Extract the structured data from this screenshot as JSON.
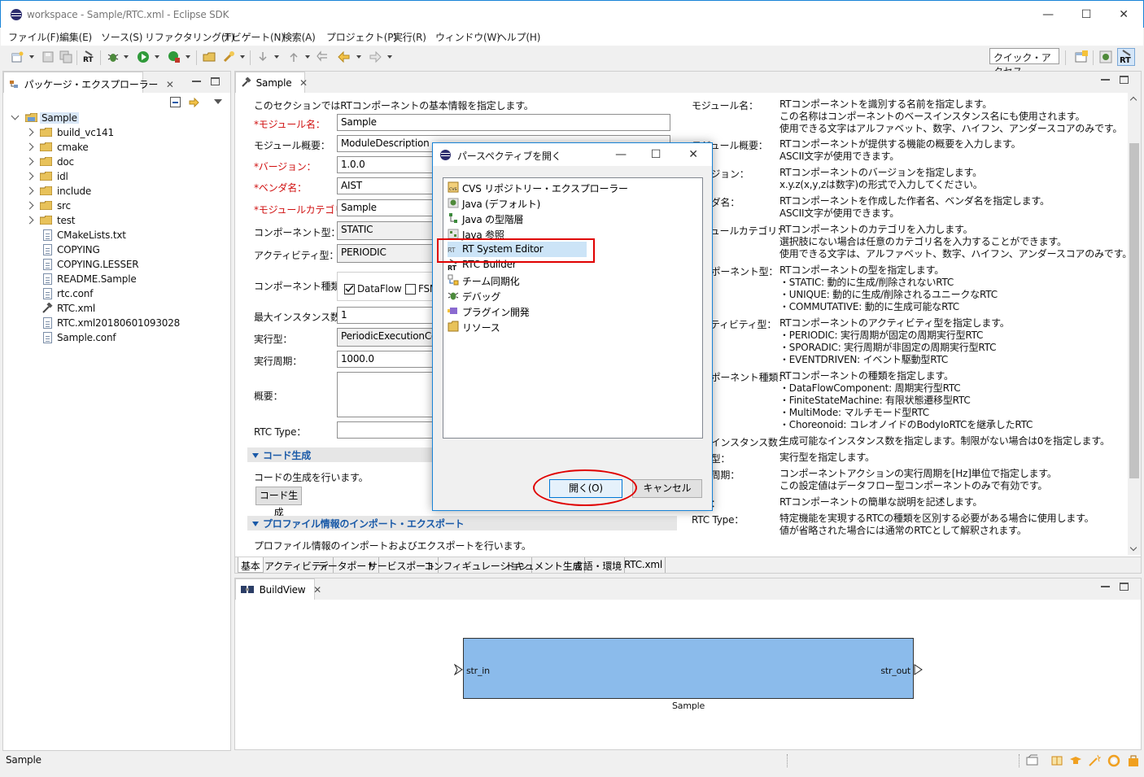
{
  "window": {
    "title": "workspace - Sample/RTC.xml - Eclipse SDK",
    "minimize": "—",
    "maximize": "☐",
    "close": "✕"
  },
  "menu": [
    "ファイル(F)",
    "編集(E)",
    "ソース(S)",
    "リファクタリング(T)",
    "ナビゲート(N)",
    "検索(A)",
    "プロジェクト(P)",
    "実行(R)",
    "ウィンドウ(W)",
    "ヘルプ(H)"
  ],
  "toolbar": {
    "quick_access": "クイック・アクセス"
  },
  "explorer": {
    "tab_label": "パッケージ・エクスプローラー",
    "root": "Sample",
    "folders": [
      "build_vc141",
      "cmake",
      "doc",
      "idl",
      "include",
      "src",
      "test"
    ],
    "files": [
      "CMakeLists.txt",
      "COPYING",
      "COPYING.LESSER",
      "README.Sample",
      "rtc.conf",
      "RTC.xml",
      "RTC.xml20180601093028",
      "Sample.conf"
    ]
  },
  "editor": {
    "tab_label": "Sample",
    "intro": "このセクションではRTコンポーネントの基本情報を指定します。",
    "fields": {
      "module_name_label": "*モジュール名：",
      "module_name": "Sample",
      "module_desc_label": "モジュール概要：",
      "module_desc": "ModuleDescription",
      "version_label": "*バージョン：",
      "version": "1.0.0",
      "vendor_label": "*ベンダ名：",
      "vendor": "AIST",
      "category_label": "*モジュールカテゴリ：",
      "category": "Sample",
      "comp_type_label": "コンポーネント型：",
      "comp_type": "STATIC",
      "activity_type_label": "アクティビティ型：",
      "activity_type": "PERIODIC",
      "comp_kind_label": "コンポーネント種類：",
      "dataflow_label": "DataFlow",
      "fsm_label": "FSM",
      "max_inst_label": "最大インスタンス数：",
      "max_inst": "1",
      "exec_type_label": "実行型：",
      "exec_type": "PeriodicExecutionContext",
      "exec_rate_label": "実行周期：",
      "exec_rate": "1000.0",
      "overview_label": "概要：",
      "rtc_type_label": "RTC Type："
    },
    "codegen_header": "コード生成",
    "codegen_desc": "コードの生成を行います。",
    "codegen_button": "コード生成",
    "profile_header": "プロファイル情報のインポート・エクスポート",
    "profile_desc": "プロファイル情報のインポートおよびエクスポートを行います。",
    "help": {
      "module_name_label": "モジュール名：",
      "module_name": "RTコンポーネントを識別する名前を指定します。\nこの名称はコンポーネントのベースインスタンス名にも使用されます。\n使用できる文字はアルファベット、数字、ハイフン、アンダースコアのみです。",
      "module_desc_label": "モジュール概要：",
      "module_desc": "RTコンポーネントが提供する機能の概要を入力します。\nASCII文字が使用できます。",
      "version_label": "バージョン：",
      "version": "RTコンポーネントのバージョンを指定します。\nx.y.z(x,y,zは数字)の形式で入力してください。",
      "vendor_label": "ベンダ名：",
      "vendor": "RTコンポーネントを作成した作者名、ベンダ名を指定します。\nASCII文字が使用できます。",
      "category_label": "モジュールカテゴリ：",
      "category": "RTコンポーネントのカテゴリを入力します。\n選択肢にない場合は任意のカテゴリ名を入力することができます。\n使用できる文字は、アルファベット、数字、ハイフン、アンダースコアのみです。",
      "comp_type_label": "コンポーネント型：",
      "comp_type": "RTコンポーネントの型を指定します。\n・STATIC: 動的に生成/削除されないRTC\n・UNIQUE: 動的に生成/削除されるユニークなRTC\n・COMMUTATIVE: 動的に生成可能なRTC",
      "activity_label": "アクティビティ型：",
      "activity": "RTコンポーネントのアクティビティ型を指定します。\n・PERIODIC: 実行周期が固定の周期実行型RTC\n・SPORADIC: 実行周期が非固定の周期実行型RTC\n・EVENTDRIVEN: イベント駆動型RTC",
      "kind_label": "コンポーネント種類：",
      "kind": "RTコンポーネントの種類を指定します。\n・DataFlowComponent: 周期実行型RTC\n・FiniteStateMachine: 有限状態遷移型RTC\n・MultiMode: マルチモード型RTC\n・Choreonoid: コレオノイドのBodyIoRTCを継承したRTC",
      "max_inst_label": "最大インスタンス数：",
      "max_inst": "生成可能なインスタンス数を指定します。制限がない場合は0を指定します。",
      "exec_type_label": "実行型：",
      "exec_type": "実行型を指定します。",
      "exec_rate_label": "実行周期：",
      "exec_rate": "コンポーネントアクションの実行周期を[Hz]単位で指定します。\nこの設定値はデータフロー型コンポーネントのみで有効です。",
      "overview_label": "概要：",
      "overview": "RTコンポーネントの簡単な説明を記述します。",
      "rtc_type_label": "RTC Type：",
      "rtc_type": "特定機能を実現するRTCの種類を区別する必要がある場合に使用します。\n値が省略された場合には通常のRTCとして解釈されます。"
    },
    "bottom_tabs": [
      "基本",
      "アクティビティ",
      "データポート",
      "サービスポート",
      "コンフィギュレーション",
      "ドキュメント生成",
      "言語・環境",
      "RTC.xml"
    ]
  },
  "buildview": {
    "tab_label": "BuildView",
    "component_name": "Sample",
    "inport": "str_in",
    "outport": "str_out",
    "fill": "#8bbbeb"
  },
  "dialog": {
    "title": "パースペクティブを開く",
    "items": [
      "CVS リポジトリー・エクスプローラー",
      "Java (デフォルト)",
      "Java の型階層",
      "Java 参照",
      "RT System Editor",
      "RTC Builder",
      "チーム同期化",
      "デバッグ",
      "プラグイン開発",
      "リソース"
    ],
    "selected": "RT System Editor",
    "open_button": "開く(O)",
    "cancel_button": "キャンセル",
    "highlight_color": "#e00000"
  },
  "status": {
    "text": "Sample"
  }
}
